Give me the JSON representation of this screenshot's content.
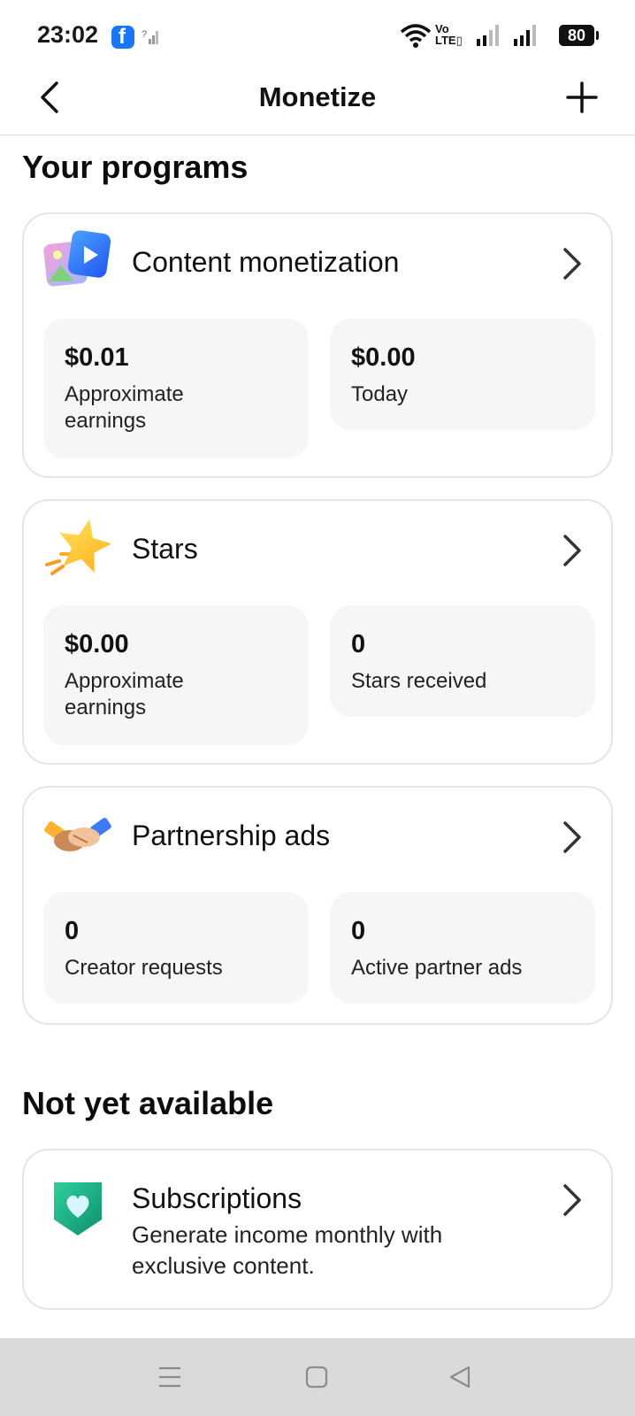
{
  "status_bar": {
    "time": "23:02",
    "battery": "80",
    "network": "VoLTE"
  },
  "header": {
    "title": "Monetize",
    "back_icon": "back-arrow-icon",
    "add_icon": "plus-icon"
  },
  "programs": {
    "section_title": "Your programs",
    "cards": [
      {
        "title": "Content monetization",
        "icon": "content-monetization-icon",
        "stats": [
          {
            "value": "$0.01",
            "label": "Approximate earnings"
          },
          {
            "value": "$0.00",
            "label": "Today"
          }
        ]
      },
      {
        "title": "Stars",
        "icon": "star-icon",
        "stats": [
          {
            "value": "$0.00",
            "label": "Approximate earnings"
          },
          {
            "value": "0",
            "label": "Stars received"
          }
        ]
      },
      {
        "title": "Partnership ads",
        "icon": "handshake-icon",
        "stats": [
          {
            "value": "0",
            "label": "Creator requests"
          },
          {
            "value": "0",
            "label": "Active partner ads"
          }
        ]
      }
    ]
  },
  "not_available": {
    "section_title": "Not yet available",
    "items": [
      {
        "title": "Subscriptions",
        "description": "Generate income monthly with exclusive content.",
        "icon": "heart-badge-icon"
      }
    ]
  },
  "colors": {
    "card_border": "#e4e5e8",
    "stat_background": "#f5f6f8",
    "nav_bar": "#d9dadc",
    "facebook_blue": "#1877f2"
  }
}
